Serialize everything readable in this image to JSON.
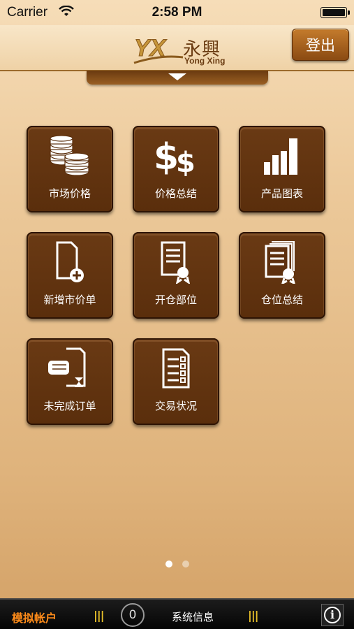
{
  "status_bar": {
    "carrier": "Carrier",
    "time": "2:58 PM",
    "battery_level": 1.0
  },
  "header": {
    "logo_mark": "YX",
    "logo_cn": "永興",
    "logo_en": "Yong Xing",
    "logout_label": "登出",
    "pull_tab_icon": "triangle-down-icon"
  },
  "menu": [
    {
      "label": "市场价格",
      "icon": "coins-icon"
    },
    {
      "label": "价格总结",
      "icon": "dollar-icon"
    },
    {
      "label": "产品图表",
      "icon": "bar-chart-icon"
    },
    {
      "label": "新增市价单",
      "icon": "add-document-icon"
    },
    {
      "label": "开仓部位",
      "icon": "certificate-icon"
    },
    {
      "label": "仓位总结",
      "icon": "certificate-stack-icon"
    },
    {
      "label": "未完成订单",
      "icon": "hand-hourglass-icon"
    },
    {
      "label": "交易状况",
      "icon": "checklist-icon"
    }
  ],
  "pager": {
    "pages": 2,
    "current": 1
  },
  "bottom_bar": {
    "account_label": "模拟帐户",
    "message_count": "0",
    "system_message_label": "系统信息",
    "info_icon": "info-icon"
  },
  "colors": {
    "tile_brown": "#5e300e",
    "accent_orange": "#ff8c1a",
    "bar_yellow": "#e8c02a"
  }
}
